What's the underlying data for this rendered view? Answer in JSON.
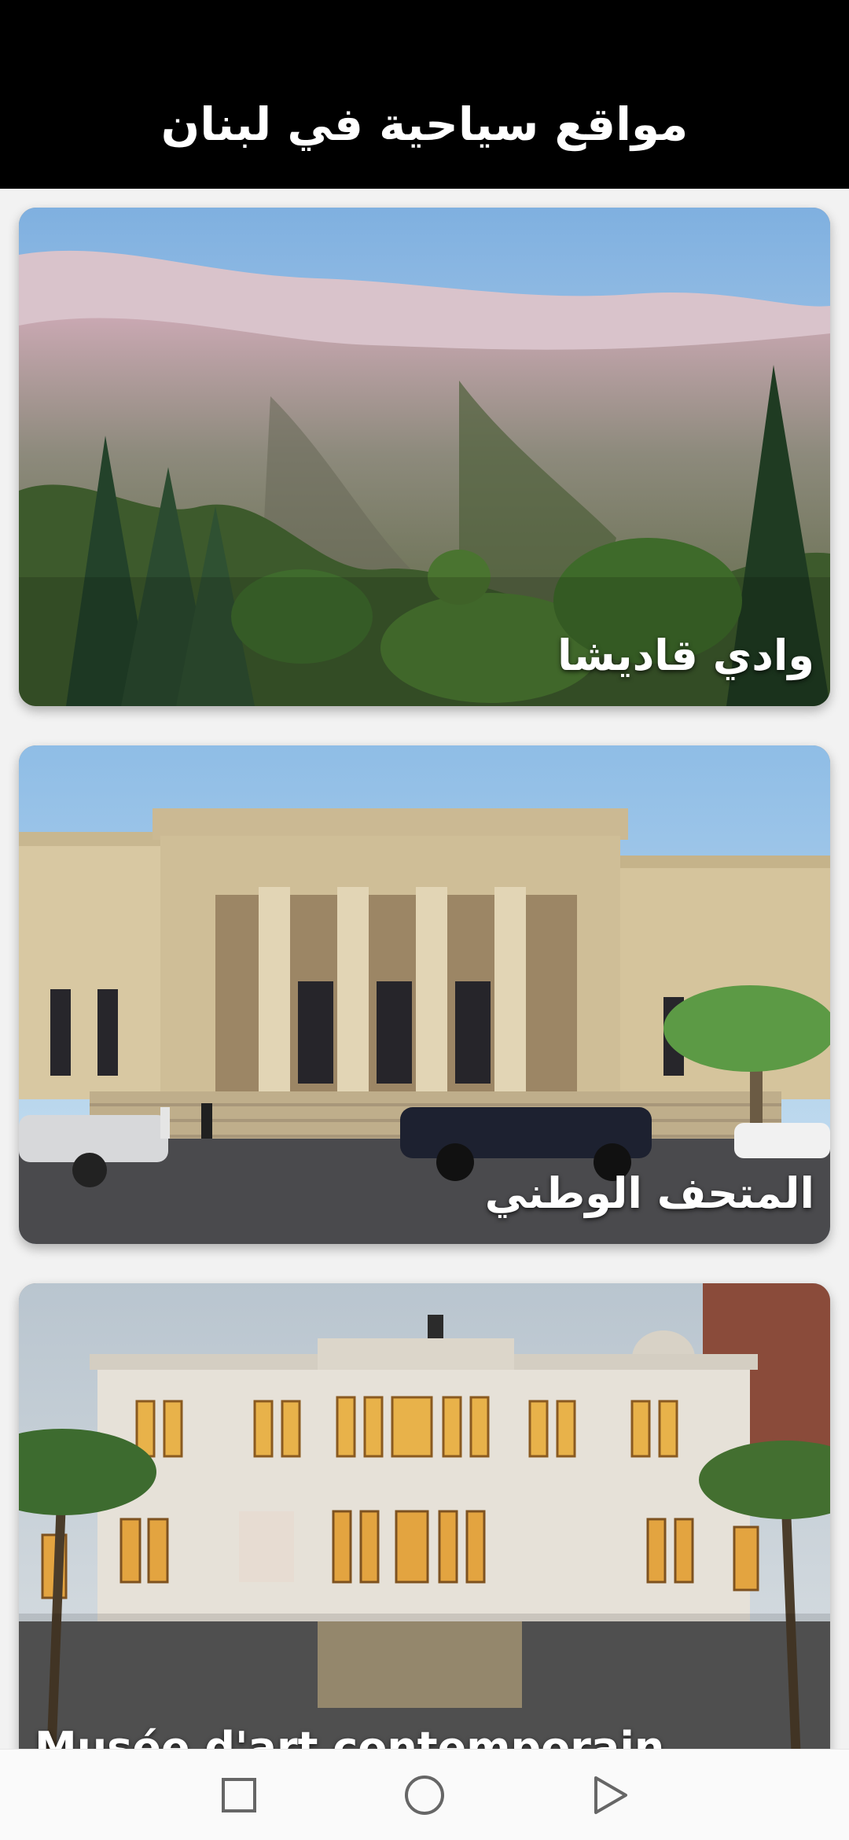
{
  "app_bar": {
    "title": "مواقع سياحية في لبنان"
  },
  "places": [
    {
      "label": "وادي قاديشا",
      "image": "qadisha-valley-photo",
      "dir": "rtl"
    },
    {
      "label": "المتحف الوطني",
      "image": "national-museum-photo",
      "dir": "rtl"
    },
    {
      "label": "Musée d'art contemporain Nicolas Sursock",
      "image": "sursock-museum-photo",
      "dir": "ltr"
    }
  ],
  "nav": {
    "recents_icon": "square-icon",
    "home_icon": "circle-icon",
    "back_icon": "triangle-icon"
  },
  "colors": {
    "app_bar": "#000000",
    "background": "#f2f2f2",
    "label_text": "#ffffff"
  }
}
